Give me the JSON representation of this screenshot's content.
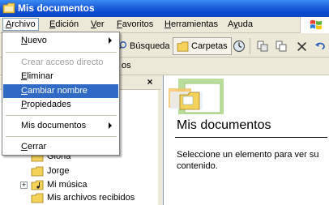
{
  "window": {
    "title": "Mis documentos"
  },
  "menubar": {
    "items": [
      {
        "label": "Archivo",
        "accel": "A",
        "rest": "rchivo"
      },
      {
        "label": "Edición",
        "accel": "E",
        "rest": "dición"
      },
      {
        "label": "Ver",
        "accel": "V",
        "rest": "er"
      },
      {
        "label": "Favoritos",
        "accel": "F",
        "rest": "avoritos"
      },
      {
        "label": "Herramientas",
        "accel": "H",
        "rest": "erramientas"
      },
      {
        "label": "Ayuda",
        "accel": "y",
        "pre": "A",
        "rest": "uda"
      }
    ]
  },
  "toolbar": {
    "search_label": "Búsqueda",
    "folders_label": "Carpetas"
  },
  "address": {
    "text_fragment": "os"
  },
  "file_menu": {
    "nuevo": {
      "accel": "N",
      "rest": "uevo"
    },
    "crear_acceso": "Crear acceso directo",
    "eliminar": {
      "accel": "E",
      "rest": "liminar"
    },
    "cambiar_nombre": {
      "accel": "C",
      "rest": "ambiar nombre"
    },
    "propiedades": {
      "accel": "P",
      "rest": "ropiedades"
    },
    "mis_documentos": "Mis documentos",
    "cerrar": {
      "accel": "C",
      "rest": "errar"
    }
  },
  "tree": {
    "items": [
      {
        "label": "Gloria"
      },
      {
        "label": "Jorge"
      },
      {
        "label": "Mi música"
      },
      {
        "label": "Mis archivos recibidos"
      }
    ]
  },
  "right_pane": {
    "title": "Mis documentos",
    "description": "Seleccione un elemento para ver su contenido."
  },
  "colors": {
    "titlebar": "#0a4ccf",
    "menu_highlight": "#316ac5",
    "folder_yellow": "#f5d25a"
  }
}
